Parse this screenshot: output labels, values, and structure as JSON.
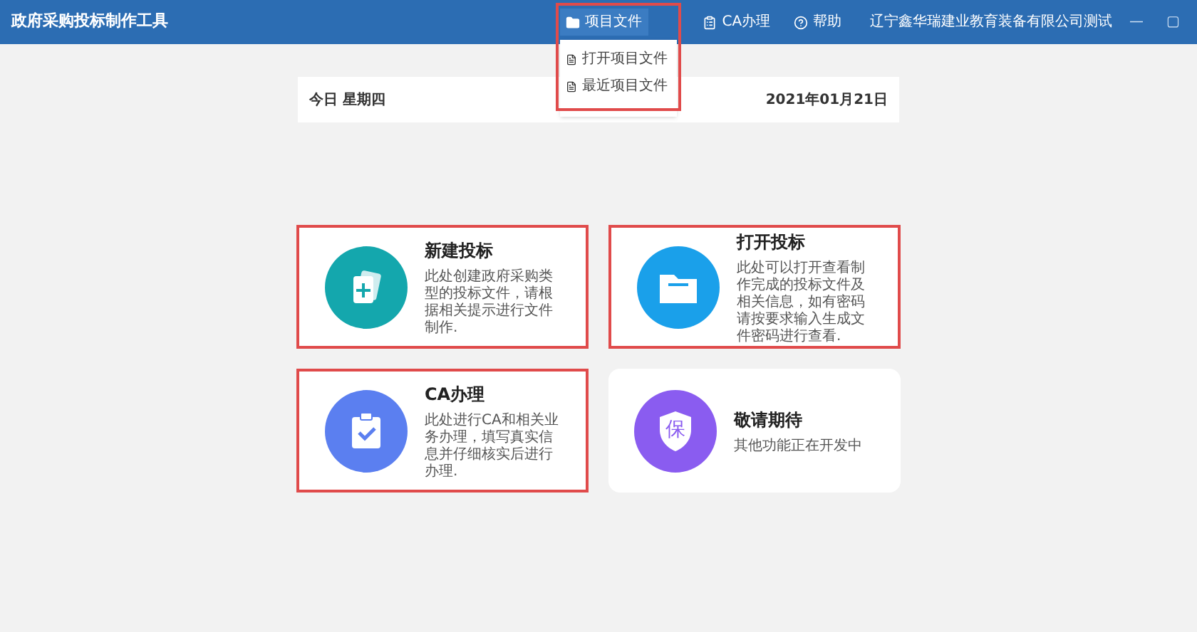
{
  "window": {
    "title": "政府采购投标制作工具",
    "user": "辽宁鑫华瑞建业教育装备有限公司测试",
    "controls": [
      "—",
      "▢"
    ]
  },
  "menu": [
    {
      "kind": "folder",
      "label": "项目文件",
      "expanded": true,
      "highlighted": true,
      "children": [
        {
          "label": "打开项目文件"
        },
        {
          "label": "最近项目文件"
        }
      ]
    },
    {
      "kind": "clipboard",
      "label": "CA办理",
      "expanded": false,
      "highlighted": false
    },
    {
      "kind": "help",
      "label": "帮助",
      "expanded": false,
      "highlighted": false
    }
  ],
  "date_bar": {
    "today": "今日 星期四",
    "date": "2021年01月21日"
  },
  "cards": [
    {
      "kind": "new",
      "title": "新建投标",
      "description": "此处创建政府采购类型的投标文件，请根据相关提示进行文件制作.",
      "color": "#14a7ad",
      "highlighted": true
    },
    {
      "kind": "open",
      "title": "打开投标",
      "description": "此处可以打开查看制作完成的投标文件及相关信息，如有密码请按要求输入生成文件密码进行查看.",
      "color": "#1aa0ea",
      "highlighted": true
    },
    {
      "kind": "ca",
      "title": "CA办理",
      "description": "此处进行CA和相关业务办理，填写真实信息并仔细核实后进行办理.",
      "color": "#5b7ff0",
      "highlighted": true
    },
    {
      "kind": "shield",
      "title": "敬请期待",
      "description": "其他功能正在开发中",
      "color": "#8a5cf0",
      "highlighted": false,
      "glyph": "保"
    }
  ]
}
